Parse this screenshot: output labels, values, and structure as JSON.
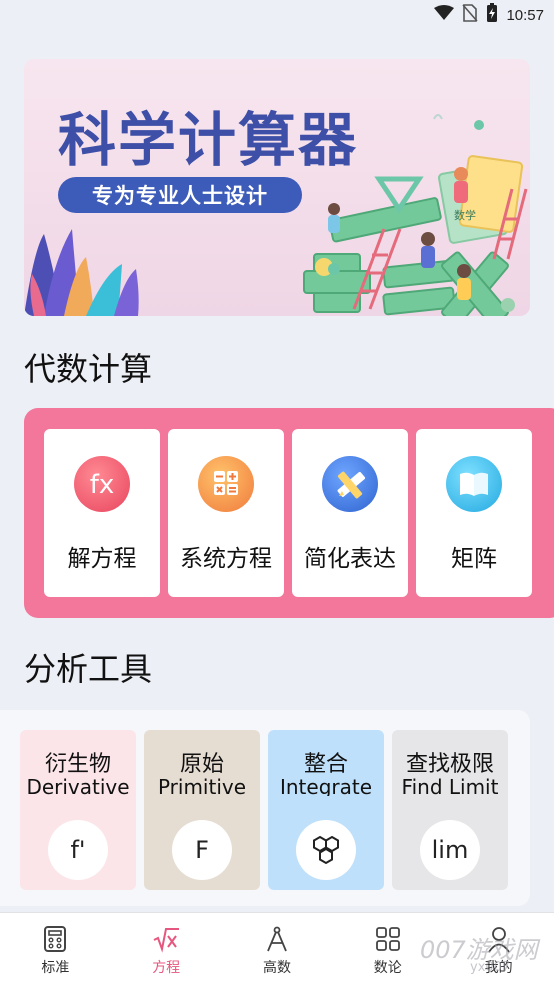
{
  "status_bar": {
    "time": "10:57"
  },
  "banner": {
    "title": "科学计算器",
    "subtitle": "专为专业人士设计",
    "book_label": "数学"
  },
  "algebra": {
    "title": "代数计算",
    "items": [
      {
        "label": "解方程",
        "icon": "fx-icon",
        "glyph": "fx",
        "color": "#f0576f"
      },
      {
        "label": "系统方程",
        "icon": "calculator-icon",
        "glyph": "",
        "color": "#f38a4b"
      },
      {
        "label": "简化表达",
        "icon": "ruler-pencil-icon",
        "glyph": "",
        "color": "#3e7de0"
      },
      {
        "label": "矩阵",
        "icon": "book-icon",
        "glyph": "",
        "color": "#38b8e6"
      }
    ]
  },
  "analysis": {
    "title": "分析工具",
    "items": [
      {
        "cn": "衍生物",
        "en": "Derivative",
        "symbol": "f'",
        "bg": "#fbe5e9"
      },
      {
        "cn": "原始",
        "en": "Primitive",
        "symbol": "F",
        "bg": "#e6ddd2"
      },
      {
        "cn": "整合",
        "en": "Integrate",
        "symbol": "",
        "bg": "#bfe0fa"
      },
      {
        "cn": "查找极限",
        "en": "Find Limit",
        "symbol": "lim",
        "bg": "#e6e6e8"
      }
    ]
  },
  "bottom_nav": {
    "items": [
      {
        "label": "标准",
        "icon": "calculator-grid-icon",
        "active": false
      },
      {
        "label": "方程",
        "icon": "sqrt-x-icon",
        "active": true
      },
      {
        "label": "高数",
        "icon": "compass-icon",
        "active": false
      },
      {
        "label": "数论",
        "icon": "four-squares-icon",
        "active": false
      },
      {
        "label": "我的",
        "icon": "person-icon",
        "active": false
      }
    ],
    "active_color": "#e6577f"
  },
  "watermark": {
    "text": "007游戏网",
    "url": "yx007"
  }
}
